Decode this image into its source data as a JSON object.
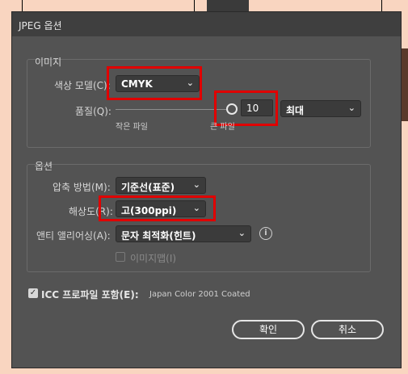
{
  "window": {
    "title": "JPEG 옵션"
  },
  "image_group": {
    "title": "이미지",
    "color_model_label": "색상 모델(C):",
    "color_model_value": "CMYK",
    "quality_label": "품질(Q):",
    "quality_value": "10",
    "quality_level": 10,
    "quality_preset_value": "최대",
    "small_file_label": "작은 파일",
    "large_file_label": "큰 파일"
  },
  "options_group": {
    "title": "옵션",
    "compression_label": "압축 방법(M):",
    "compression_value": "기준선(표준)",
    "resolution_label": "해상도(R):",
    "resolution_value": "고(300ppi)",
    "antialias_label": "앤티 앨리어싱(A):",
    "antialias_value": "문자 최적화(힌트)",
    "imagemap_label": "이미지맵(I)"
  },
  "icc": {
    "label": "ICC 프로파일 포함(E):",
    "profile": "Japan Color 2001 Coated",
    "checked": true
  },
  "buttons": {
    "ok": "확인",
    "cancel": "취소"
  },
  "icons": {
    "info": "info-icon",
    "chevron": "chevron-down-icon",
    "check": "checkmark-icon"
  },
  "colors": {
    "highlight": "#e00000",
    "dialog_bg": "#535353",
    "field_bg": "#3b3b3b"
  }
}
